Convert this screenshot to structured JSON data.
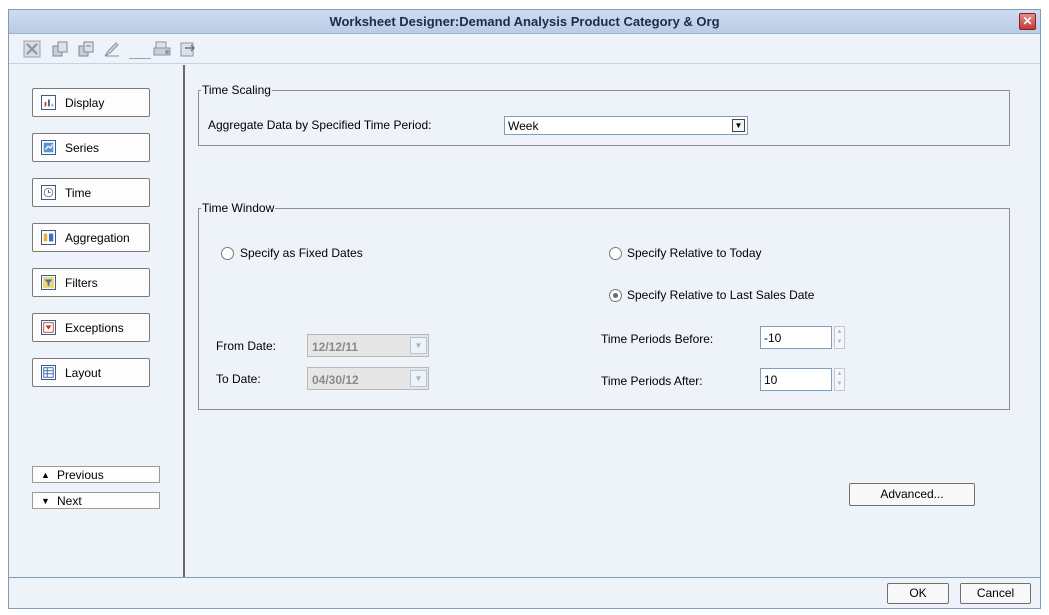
{
  "window": {
    "title": "Worksheet Designer:Demand Analysis Product Category & Org",
    "close_glyph": "✕"
  },
  "toolbar": {
    "icons": [
      "cut-icon",
      "copy-icon",
      "paste-icon",
      "edit-icon",
      "print-icon",
      "export-icon"
    ]
  },
  "nav": {
    "items": [
      {
        "label": "Display",
        "icon": "bar-chart-icon"
      },
      {
        "label": "Series",
        "icon": "series-icon"
      },
      {
        "label": "Time",
        "icon": "clock-icon"
      },
      {
        "label": "Aggregation",
        "icon": "aggregation-icon"
      },
      {
        "label": "Filters",
        "icon": "filter-icon"
      },
      {
        "label": "Exceptions",
        "icon": "exceptions-icon"
      },
      {
        "label": "Layout",
        "icon": "layout-icon"
      }
    ],
    "previous_label": "Previous",
    "next_label": "Next"
  },
  "time_scaling": {
    "legend": "Time Scaling",
    "aggregate_label": "Aggregate Data by Specified Time Period:",
    "aggregate_value": "Week"
  },
  "time_window": {
    "legend": "Time Window",
    "fixed_dates_label": "Specify as Fixed Dates",
    "relative_today_label": "Specify Relative to Today",
    "relative_sales_label": "Specify Relative to Last Sales Date",
    "selected": "relative_sales",
    "from_label": "From Date:",
    "from_value": "12/12/11",
    "to_label": "To Date:",
    "to_value": "04/30/12",
    "before_label": "Time Periods Before:",
    "before_value": "-10",
    "after_label": "Time Periods After:",
    "after_value": "10"
  },
  "buttons": {
    "advanced": "Advanced...",
    "ok": "OK",
    "cancel": "Cancel"
  },
  "colors": {
    "window_bg": "#eef2f9",
    "title_bg": "#c4d4ec",
    "close_red": "#c23a3a"
  }
}
